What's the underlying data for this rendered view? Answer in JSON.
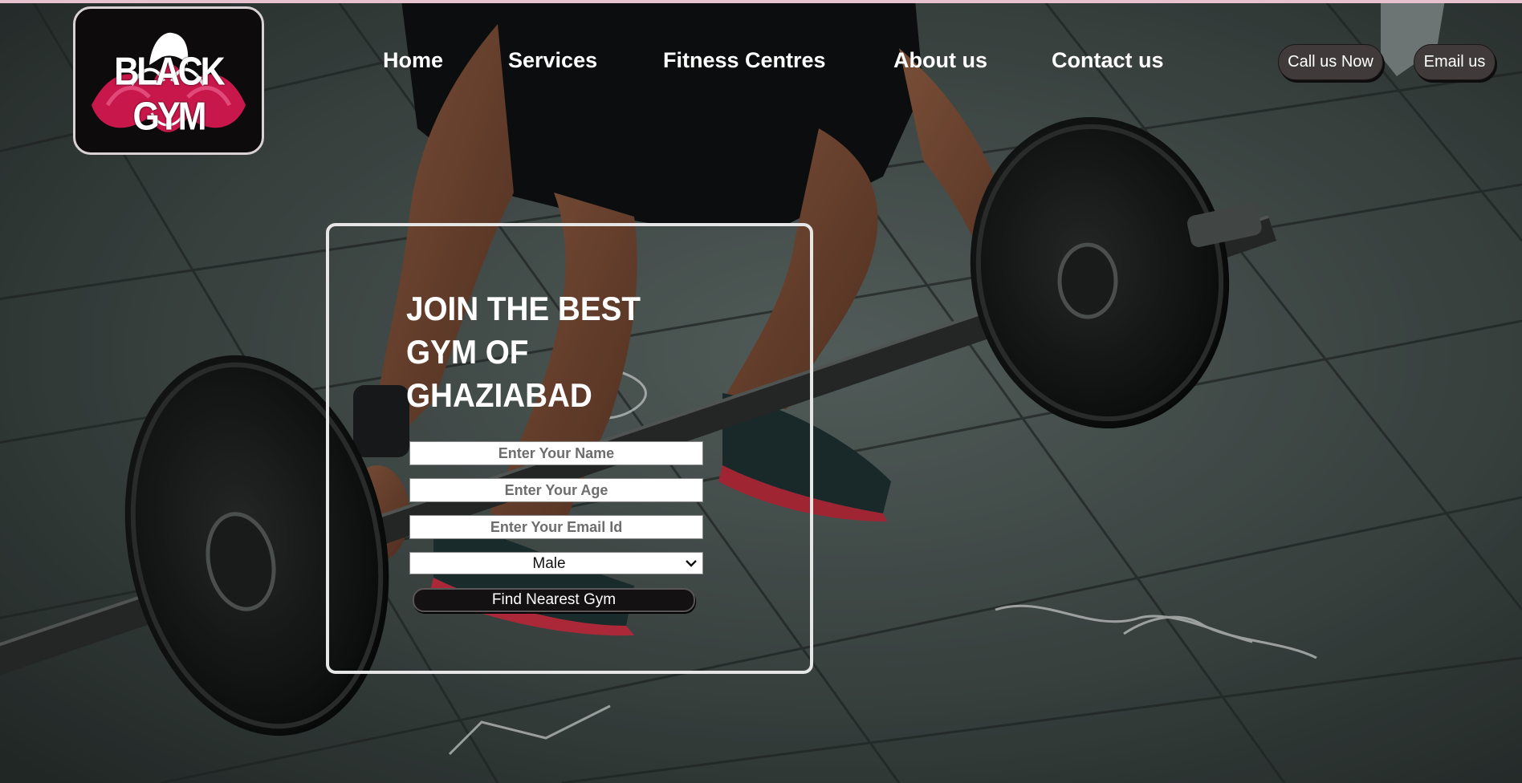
{
  "brand": {
    "logo_text": "BLACK GYM",
    "accent_color": "#c8174a"
  },
  "nav": {
    "items": [
      {
        "label": "Home"
      },
      {
        "label": "Services"
      },
      {
        "label": "Fitness Centres"
      },
      {
        "label": "About us"
      },
      {
        "label": "Contact us"
      }
    ]
  },
  "actions": {
    "call_label": "Call us Now",
    "email_label": "Email us"
  },
  "hero_form": {
    "headline_lines": [
      "JOIN THE BEST",
      "GYM OF",
      "GHAZIABAD"
    ],
    "name_placeholder": "Enter Your Name",
    "age_placeholder": "Enter Your Age",
    "email_placeholder": "Enter Your Email Id",
    "gender_selected": "Male",
    "submit_label": "Find Nearest Gym"
  },
  "colors": {
    "button_bg": "#403a3b",
    "top_border": "#e7c3cf"
  }
}
